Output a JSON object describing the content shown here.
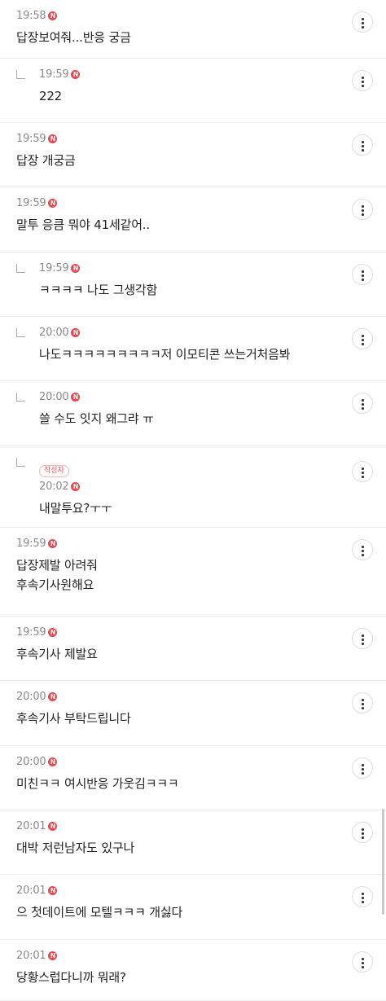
{
  "comments": [
    {
      "time": "19:58",
      "badge": "N",
      "text": "답장보여줘...반응 궁금",
      "reply": false,
      "author": "",
      "height": 72
    },
    {
      "time": "19:59",
      "badge": "N",
      "text": "222",
      "reply": true,
      "author": "",
      "height": 79
    },
    {
      "time": "19:59",
      "badge": "N",
      "text": "답장 개궁금",
      "reply": false,
      "author": "",
      "height": 79
    },
    {
      "time": "19:59",
      "badge": "N",
      "text": "말투 응큼 뭐야 41세같어..",
      "reply": false,
      "author": "",
      "height": 80
    },
    {
      "time": "19:59",
      "badge": "N",
      "text": "ㅋㅋㅋㅋ 나도 그생각함",
      "reply": true,
      "author": "",
      "height": 79
    },
    {
      "time": "20:00",
      "badge": "N",
      "text": "나도ㅋㅋㅋㅋㅋㅋㅋㅋㅋ저 이모티콘 쓰는거처음봐",
      "reply": true,
      "author": "",
      "height": 79
    },
    {
      "time": "20:00",
      "badge": "N",
      "text": "쓸 수도 잇지 왜그랴 ㅠ",
      "reply": true,
      "author": "",
      "height": 80
    },
    {
      "time": "20:02",
      "badge": "N",
      "text": "내말투요?ㅜㅜ",
      "reply": true,
      "author": "작성자",
      "height": 100
    },
    {
      "time": "19:59",
      "badge": "N",
      "text": "답장제발 아려줘\n후속기사원해요",
      "reply": false,
      "author": "",
      "height": 109
    },
    {
      "time": "19:59",
      "badge": "N",
      "text": "후속기사 제발요",
      "reply": false,
      "author": "",
      "height": 79
    },
    {
      "time": "20:00",
      "badge": "N",
      "text": "후속기사 부탁드립니다",
      "reply": false,
      "author": "",
      "height": 80
    },
    {
      "time": "20:00",
      "badge": "N",
      "text": "미친ㅋㅋ 여시반응 가웃김ㅋㅋㅋ",
      "reply": false,
      "author": "",
      "height": 79
    },
    {
      "time": "20:01",
      "badge": "N",
      "text": "대박 저런남자도 있구나",
      "reply": false,
      "author": "",
      "height": 79
    },
    {
      "time": "20:01",
      "badge": "N",
      "text": "으 첫데이트에 모텔ㅋㅋㅋ 개싫다",
      "reply": false,
      "author": "",
      "height": 80
    },
    {
      "time": "20:01",
      "badge": "N",
      "text": "당황스럽다니까 뭐래?",
      "reply": false,
      "author": "",
      "height": 75
    }
  ]
}
